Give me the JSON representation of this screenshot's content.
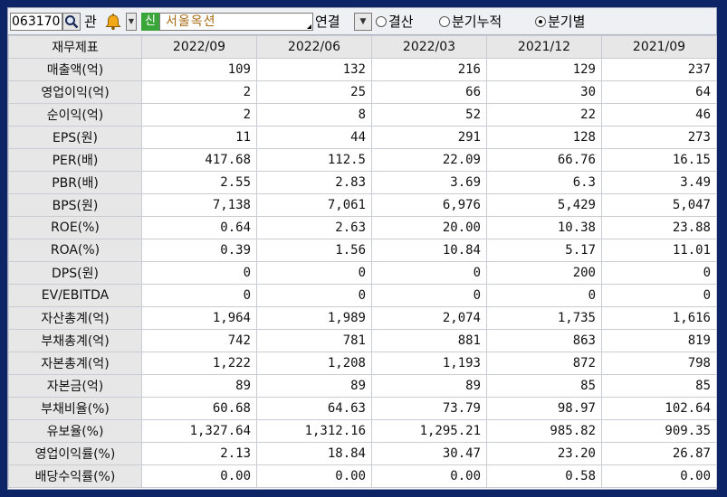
{
  "toolbar": {
    "stock_code": "063170",
    "gwan_label": "관",
    "new_badge": "신",
    "stock_name": "서울옥션",
    "consolidated_label": "연결",
    "radio_options": [
      {
        "label": "결산",
        "selected": false
      },
      {
        "label": "분기누적",
        "selected": false
      },
      {
        "label": "분기별",
        "selected": true
      }
    ]
  },
  "table": {
    "header_label": "재무제표",
    "periods": [
      "2022/09",
      "2022/06",
      "2022/03",
      "2021/12",
      "2021/09"
    ],
    "rows": [
      {
        "label": "매출액(억)",
        "values": [
          "109",
          "132",
          "216",
          "129",
          "237"
        ]
      },
      {
        "label": "영업이익(억)",
        "values": [
          "2",
          "25",
          "66",
          "30",
          "64"
        ]
      },
      {
        "label": "순이익(억)",
        "values": [
          "2",
          "8",
          "52",
          "22",
          "46"
        ]
      },
      {
        "label": "EPS(원)",
        "values": [
          "11",
          "44",
          "291",
          "128",
          "273"
        ]
      },
      {
        "label": "PER(배)",
        "values": [
          "417.68",
          "112.5",
          "22.09",
          "66.76",
          "16.15"
        ]
      },
      {
        "label": "PBR(배)",
        "values": [
          "2.55",
          "2.83",
          "3.69",
          "6.3",
          "3.49"
        ]
      },
      {
        "label": "BPS(원)",
        "values": [
          "7,138",
          "7,061",
          "6,976",
          "5,429",
          "5,047"
        ]
      },
      {
        "label": "ROE(%)",
        "values": [
          "0.64",
          "2.63",
          "20.00",
          "10.38",
          "23.88"
        ]
      },
      {
        "label": "ROA(%)",
        "values": [
          "0.39",
          "1.56",
          "10.84",
          "5.17",
          "11.01"
        ]
      },
      {
        "label": "DPS(원)",
        "values": [
          "0",
          "0",
          "0",
          "200",
          "0"
        ]
      },
      {
        "label": "EV/EBITDA",
        "values": [
          "0",
          "0",
          "0",
          "0",
          "0"
        ]
      },
      {
        "label": "자산총계(억)",
        "values": [
          "1,964",
          "1,989",
          "2,074",
          "1,735",
          "1,616"
        ]
      },
      {
        "label": "부채총계(억)",
        "values": [
          "742",
          "781",
          "881",
          "863",
          "819"
        ]
      },
      {
        "label": "자본총계(억)",
        "values": [
          "1,222",
          "1,208",
          "1,193",
          "872",
          "798"
        ]
      },
      {
        "label": "자본금(억)",
        "values": [
          "89",
          "89",
          "89",
          "85",
          "85"
        ]
      },
      {
        "label": "부채비율(%)",
        "values": [
          "60.68",
          "64.63",
          "73.79",
          "98.97",
          "102.64"
        ]
      },
      {
        "label": "유보율(%)",
        "values": [
          "1,327.64",
          "1,312.16",
          "1,295.21",
          "985.82",
          "909.35"
        ]
      },
      {
        "label": "영업이익률(%)",
        "values": [
          "2.13",
          "18.84",
          "30.47",
          "23.20",
          "26.87"
        ]
      },
      {
        "label": "배당수익률(%)",
        "values": [
          "0.00",
          "0.00",
          "0.00",
          "0.58",
          "0.00"
        ]
      }
    ]
  },
  "colors": {
    "background": "#0d2466",
    "header_bg": "#e7e7e7",
    "new_badge": "#3aa63a",
    "stock_name_text": "#a86b14",
    "bell": "#f2a817"
  },
  "icons": {
    "search": "magnifier-icon",
    "bell": "bell-icon"
  }
}
